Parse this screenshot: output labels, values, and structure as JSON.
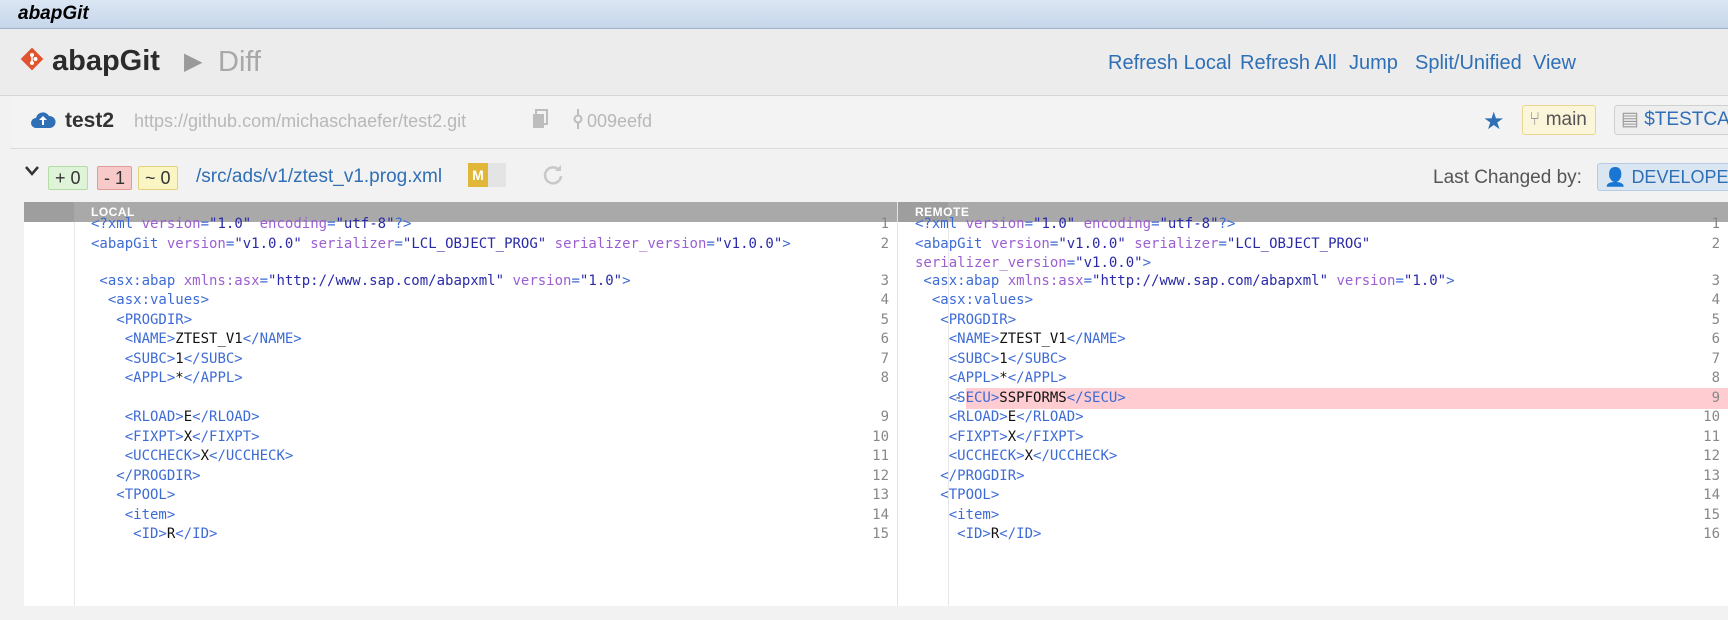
{
  "window": {
    "title": "abapGit"
  },
  "header": {
    "app_name": "abapGit",
    "page": "Diff",
    "nav": [
      "Refresh Local",
      "Refresh All",
      "Jump",
      "Split/Unified",
      "View"
    ]
  },
  "repo": {
    "name": "test2",
    "url": "https://github.com/michaschaefer/test2.git",
    "commit": "009eefd",
    "branch": "main",
    "package": "$TESTCA"
  },
  "file": {
    "stats": {
      "added": "+ 0",
      "deleted": "- 1",
      "modified": "~ 0"
    },
    "path": "/src/ads/v1/ztest_v1.prog.xml",
    "status_badge": "M",
    "last_changed_label": "Last Changed by:",
    "user": "DEVELOPER"
  },
  "diff": {
    "local_label": "LOCAL",
    "remote_label": "REMOTE",
    "local_lines": [
      {
        "n": "1",
        "segs": [
          [
            "c-tag",
            "<?xml "
          ],
          [
            "c-attr",
            "version"
          ],
          [
            "c-tag",
            "="
          ],
          [
            "c-val",
            "\"1.0\""
          ],
          [
            "c-tag",
            " "
          ],
          [
            "c-attr",
            "encoding"
          ],
          [
            "c-tag",
            "="
          ],
          [
            "c-val",
            "\"utf-8\""
          ],
          [
            "c-tag",
            "?>"
          ]
        ]
      },
      {
        "n": "2",
        "segs": [
          [
            "c-tag",
            "<abapGit "
          ],
          [
            "c-attr",
            "version"
          ],
          [
            "c-tag",
            "="
          ],
          [
            "c-val",
            "\"v1.0.0\""
          ],
          [
            "c-tag",
            " "
          ],
          [
            "c-attr",
            "serializer"
          ],
          [
            "c-tag",
            "="
          ],
          [
            "c-val",
            "\"LCL_OBJECT_PROG\""
          ],
          [
            "c-tag",
            " "
          ],
          [
            "c-attr",
            "serializer_version"
          ],
          [
            "c-tag",
            "="
          ],
          [
            "c-val",
            "\"v1.0.0\""
          ],
          [
            "c-tag",
            ">"
          ]
        ]
      },
      {
        "n": "3",
        "segs": [
          [
            "c-tag",
            " <asx:abap "
          ],
          [
            "c-attr",
            "xmlns:asx"
          ],
          [
            "c-tag",
            "="
          ],
          [
            "c-val",
            "\"http://www.sap.com/abapxml\""
          ],
          [
            "c-tag",
            " "
          ],
          [
            "c-attr",
            "version"
          ],
          [
            "c-tag",
            "="
          ],
          [
            "c-val",
            "\"1.0\""
          ],
          [
            "c-tag",
            ">"
          ]
        ]
      },
      {
        "n": "4",
        "segs": [
          [
            "c-tag",
            "  <asx:values>"
          ]
        ]
      },
      {
        "n": "5",
        "segs": [
          [
            "c-tag",
            "   <PROGDIR>"
          ]
        ]
      },
      {
        "n": "6",
        "segs": [
          [
            "c-tag",
            "    <NAME>"
          ],
          [
            "c-txt",
            "ZTEST_V1"
          ],
          [
            "c-tag",
            "</NAME>"
          ]
        ]
      },
      {
        "n": "7",
        "segs": [
          [
            "c-tag",
            "    <SUBC>"
          ],
          [
            "c-txt",
            "1"
          ],
          [
            "c-tag",
            "</SUBC>"
          ]
        ]
      },
      {
        "n": "8",
        "segs": [
          [
            "c-tag",
            "    <APPL>"
          ],
          [
            "c-txt",
            "*"
          ],
          [
            "c-tag",
            "</APPL>"
          ]
        ]
      },
      {
        "n": "9",
        "segs": [
          [
            "c-tag",
            "    <RLOAD>"
          ],
          [
            "c-txt",
            "E"
          ],
          [
            "c-tag",
            "</RLOAD>"
          ]
        ]
      },
      {
        "n": "10",
        "segs": [
          [
            "c-tag",
            "    <FIXPT>"
          ],
          [
            "c-txt",
            "X"
          ],
          [
            "c-tag",
            "</FIXPT>"
          ]
        ]
      },
      {
        "n": "11",
        "segs": [
          [
            "c-tag",
            "    <UCCHECK>"
          ],
          [
            "c-txt",
            "X"
          ],
          [
            "c-tag",
            "</UCCHECK>"
          ]
        ]
      },
      {
        "n": "12",
        "segs": [
          [
            "c-tag",
            "   </PROGDIR>"
          ]
        ]
      },
      {
        "n": "13",
        "segs": [
          [
            "c-tag",
            "   <TPOOL>"
          ]
        ]
      },
      {
        "n": "14",
        "segs": [
          [
            "c-tag",
            "    <item>"
          ]
        ]
      },
      {
        "n": "15",
        "segs": [
          [
            "c-tag",
            "     <ID>"
          ],
          [
            "c-txt",
            "R"
          ],
          [
            "c-tag",
            "</ID>"
          ]
        ]
      }
    ],
    "remote_lines": [
      {
        "n": "1",
        "segs": [
          [
            "c-tag",
            "<?xml "
          ],
          [
            "c-attr",
            "version"
          ],
          [
            "c-tag",
            "="
          ],
          [
            "c-val",
            "\"1.0\""
          ],
          [
            "c-tag",
            " "
          ],
          [
            "c-attr",
            "encoding"
          ],
          [
            "c-tag",
            "="
          ],
          [
            "c-val",
            "\"utf-8\""
          ],
          [
            "c-tag",
            "?>"
          ]
        ]
      },
      {
        "n": "2",
        "segs": [
          [
            "c-tag",
            "<abapGit "
          ],
          [
            "c-attr",
            "version"
          ],
          [
            "c-tag",
            "="
          ],
          [
            "c-val",
            "\"v1.0.0\""
          ],
          [
            "c-tag",
            " "
          ],
          [
            "c-attr",
            "serializer"
          ],
          [
            "c-tag",
            "="
          ],
          [
            "c-val",
            "\"LCL_OBJECT_PROG\""
          ]
        ]
      },
      {
        "n": "",
        "segs": [
          [
            "c-attr",
            "serializer_version"
          ],
          [
            "c-tag",
            "="
          ],
          [
            "c-val",
            "\"v1.0.0\""
          ],
          [
            "c-tag",
            ">"
          ]
        ]
      },
      {
        "n": "3",
        "segs": [
          [
            "c-tag",
            " <asx:abap "
          ],
          [
            "c-attr",
            "xmlns:asx"
          ],
          [
            "c-tag",
            "="
          ],
          [
            "c-val",
            "\"http://www.sap.com/abapxml\""
          ],
          [
            "c-tag",
            " "
          ],
          [
            "c-attr",
            "version"
          ],
          [
            "c-tag",
            "="
          ],
          [
            "c-val",
            "\"1.0\""
          ],
          [
            "c-tag",
            ">"
          ]
        ]
      },
      {
        "n": "4",
        "segs": [
          [
            "c-tag",
            "  <asx:values>"
          ]
        ]
      },
      {
        "n": "5",
        "segs": [
          [
            "c-tag",
            "   <PROGDIR>"
          ]
        ]
      },
      {
        "n": "6",
        "segs": [
          [
            "c-tag",
            "    <NAME>"
          ],
          [
            "c-txt",
            "ZTEST_V1"
          ],
          [
            "c-tag",
            "</NAME>"
          ]
        ]
      },
      {
        "n": "7",
        "segs": [
          [
            "c-tag",
            "    <SUBC>"
          ],
          [
            "c-txt",
            "1"
          ],
          [
            "c-tag",
            "</SUBC>"
          ]
        ]
      },
      {
        "n": "8",
        "segs": [
          [
            "c-tag",
            "    <APPL>"
          ],
          [
            "c-txt",
            "*"
          ],
          [
            "c-tag",
            "</APPL>"
          ]
        ]
      },
      {
        "n": "9",
        "mark": "-",
        "segs": [
          [
            "c-tag",
            "    <SECU>"
          ],
          [
            "c-txt",
            "SSPFORMS"
          ],
          [
            "c-tag",
            "</SECU>"
          ]
        ]
      },
      {
        "n": "10",
        "segs": [
          [
            "c-tag",
            "    <RLOAD>"
          ],
          [
            "c-txt",
            "E"
          ],
          [
            "c-tag",
            "</RLOAD>"
          ]
        ]
      },
      {
        "n": "11",
        "segs": [
          [
            "c-tag",
            "    <FIXPT>"
          ],
          [
            "c-txt",
            "X"
          ],
          [
            "c-tag",
            "</FIXPT>"
          ]
        ]
      },
      {
        "n": "12",
        "segs": [
          [
            "c-tag",
            "    <UCCHECK>"
          ],
          [
            "c-txt",
            "X"
          ],
          [
            "c-tag",
            "</UCCHECK>"
          ]
        ]
      },
      {
        "n": "13",
        "segs": [
          [
            "c-tag",
            "   </PROGDIR>"
          ]
        ]
      },
      {
        "n": "14",
        "segs": [
          [
            "c-tag",
            "   <TPOOL>"
          ]
        ]
      },
      {
        "n": "15",
        "segs": [
          [
            "c-tag",
            "    <item>"
          ]
        ]
      },
      {
        "n": "16",
        "segs": [
          [
            "c-tag",
            "     <ID>"
          ],
          [
            "c-txt",
            "R"
          ],
          [
            "c-tag",
            "</ID>"
          ]
        ]
      }
    ]
  }
}
